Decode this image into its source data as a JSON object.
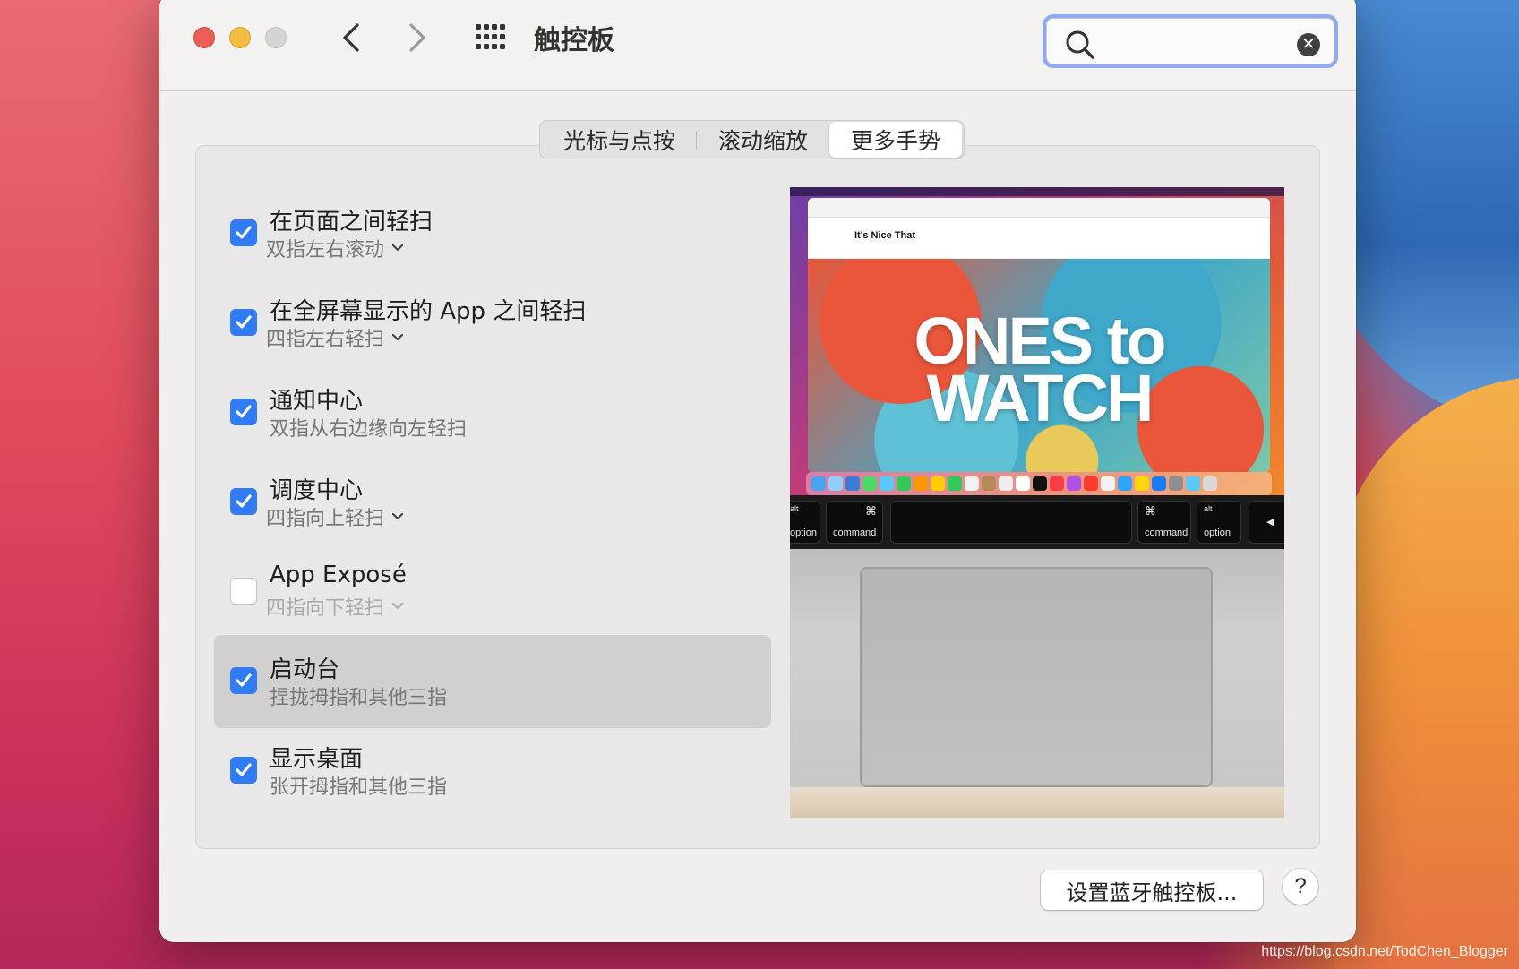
{
  "window": {
    "title": "触控板",
    "search": {
      "value": "",
      "placeholder": ""
    }
  },
  "tabs": [
    {
      "label": "光标与点按",
      "active": false
    },
    {
      "label": "滚动缩放",
      "active": false
    },
    {
      "label": "更多手势",
      "active": true
    }
  ],
  "gestures": [
    {
      "title": "在页面之间轻扫",
      "subtitle": "双指左右滚动",
      "checked": true,
      "has_dropdown": true
    },
    {
      "title": "在全屏幕显示的 App 之间轻扫",
      "subtitle": "四指左右轻扫",
      "checked": true,
      "has_dropdown": true
    },
    {
      "title": "通知中心",
      "subtitle": "双指从右边缘向左轻扫",
      "checked": true,
      "has_dropdown": false
    },
    {
      "title": "调度中心",
      "subtitle": "四指向上轻扫",
      "checked": true,
      "has_dropdown": true
    },
    {
      "title": "App Exposé",
      "subtitle": "四指向下轻扫",
      "checked": false,
      "has_dropdown": true
    },
    {
      "title": "启动台",
      "subtitle": "捏拢拇指和其他三指",
      "checked": true,
      "has_dropdown": false,
      "selected": true
    },
    {
      "title": "显示桌面",
      "subtitle": "张开拇指和其他三指",
      "checked": true,
      "has_dropdown": false
    }
  ],
  "preview": {
    "site_name": "It's Nice That",
    "hero_line1": "ONES to",
    "hero_line2": "WATCH",
    "keys": {
      "left_alt_top": "alt",
      "left_alt_bottom": "option",
      "left_cmd_top": "⌘",
      "left_cmd_bottom": "command",
      "right_cmd_top": "⌘",
      "right_cmd_bottom": "command",
      "right_alt_top": "alt",
      "right_alt_bottom": "option",
      "arrow": "◀"
    }
  },
  "buttons": {
    "bluetooth": "设置蓝牙触控板...",
    "help": "?"
  },
  "watermark": "https://blog.csdn.net/TodChen_Blogger",
  "colors": {
    "accent": "#2f7cf6",
    "search_focus": "#8fa9f2",
    "close": "#ec5f57",
    "minimize": "#f3bd42",
    "zoom": "#d6d3d3"
  }
}
